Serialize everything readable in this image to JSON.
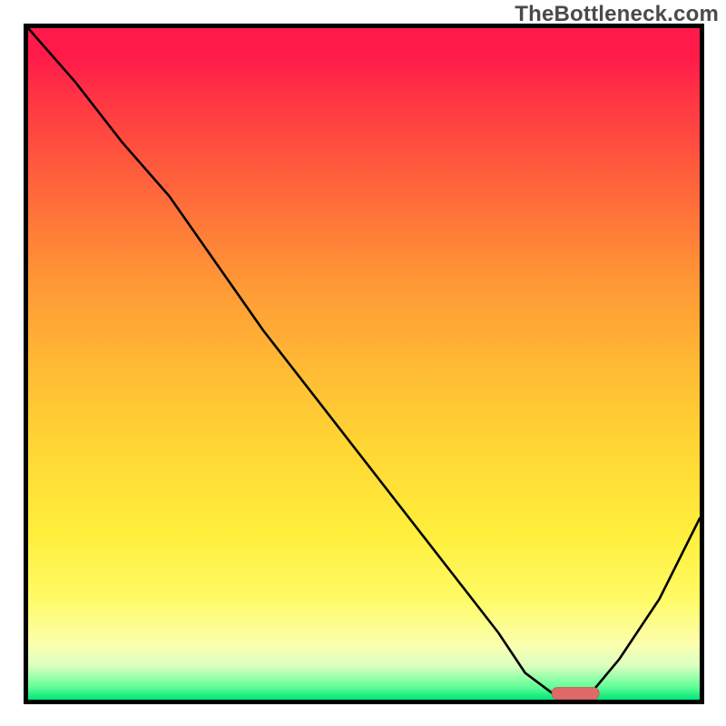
{
  "watermark": "TheBottleneck.com",
  "chart_data": {
    "type": "line",
    "title": "",
    "xlabel": "",
    "ylabel": "",
    "xlim": [
      0,
      100
    ],
    "ylim": [
      0,
      100
    ],
    "grid": false,
    "background": "red-to-green vertical gradient (high=red, low=green)",
    "series": [
      {
        "name": "bottleneck-curve",
        "x": [
          0,
          7,
          14,
          21,
          28,
          35,
          42,
          49,
          56,
          63,
          70,
          74,
          78,
          81,
          83,
          88,
          94,
          100
        ],
        "values": [
          100,
          92,
          83,
          75,
          65,
          55,
          46,
          37,
          28,
          19,
          10,
          4,
          1,
          0,
          0,
          6,
          15,
          27
        ]
      }
    ],
    "marker": {
      "name": "optimal-range",
      "shape": "rounded-bar",
      "x_start": 78,
      "x_end": 85,
      "y": 1,
      "color": "#e06a6a"
    }
  }
}
